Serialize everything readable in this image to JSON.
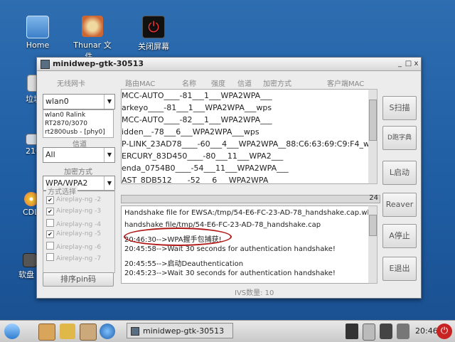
{
  "desktop": {
    "icons": [
      {
        "label": "Home"
      },
      {
        "label": "Thunar 文件..."
      },
      {
        "label": "关闭屏幕"
      }
    ],
    "left_labels": [
      "垃圾",
      "21G",
      "CDL",
      "软盘"
    ]
  },
  "window": {
    "title": "minidwep-gtk-30513",
    "controls": {
      "min": "_",
      "max": "□",
      "close": "x"
    }
  },
  "headers": {
    "nic": "无线网卡",
    "mac": "路由MAC",
    "name": "名称",
    "strength": "强度",
    "channel": "信道",
    "encryption": "加密方式",
    "client_mac": "客户端MAC"
  },
  "nic": {
    "selected": "wlan0",
    "info": [
      "wlan0 Ralink",
      "RT2870/3070",
      "rt2800usb - [phy0]"
    ]
  },
  "channel": {
    "label": "信道",
    "selected": "All"
  },
  "encryption": {
    "label": "加密方式",
    "selected": "WPA/WPA2"
  },
  "modes": {
    "legend": "方式选择",
    "items": [
      {
        "label": "Aireplay-ng -2",
        "checked": true
      },
      {
        "label": "Aireplay-ng -3",
        "checked": true
      },
      {
        "label": "Aireplay-ng -4",
        "checked": false
      },
      {
        "label": "Aireplay-ng -5",
        "checked": true
      },
      {
        "label": "Aireplay-ng -6",
        "checked": false
      },
      {
        "label": "Aireplay-ng -7",
        "checked": false
      }
    ]
  },
  "sort_button": "排序pin码",
  "buttons": {
    "scan": "S扫描",
    "dict": "D跑字典",
    "start": "L启动",
    "reaver": "Reaver",
    "stop": "A停止",
    "exit": "E退出"
  },
  "ap_rows": [
    "MCC-AUTO____-81___1___WPA2WPA___",
    "arkeyo____-81___1___WPA2WPA___wps",
    "MCC-AUTO____-82___1___WPA2WPA___",
    "idden__-78___6___WPA2WPA___wps",
    "P-LINK_23AD78____-60___4___WPA2WPA__88:C6:63:69:C9:F4_wps",
    "ERCURY_83D450____-80___11___WPA2___",
    "enda_0754B0____-54___11___WPA2WPA___",
    "AST_8DB512____-52___6___WPA2WPA"
  ],
  "progress": {
    "value": "24"
  },
  "log_lines": [
    "Handshake file for EWSA:/tmp/54-E6-FC-23-AD-78_handshake.cap.wkp",
    "handshake file/tmp/54-E6-FC-23-AD-78_handshake.cap",
    "20:46:30-->WPA握手包捕获!",
    "20:45:58-->Wait 30 seconds for authentication handshake!",
    "20:45:55-->启动Deauthentication",
    "20:45:23-->Wait 30 seconds for authentication handshake!"
  ],
  "ivs": "IVS数量: 10",
  "taskbar": {
    "task_label": "minidwep-gtk-30513",
    "clock": "20:46"
  }
}
